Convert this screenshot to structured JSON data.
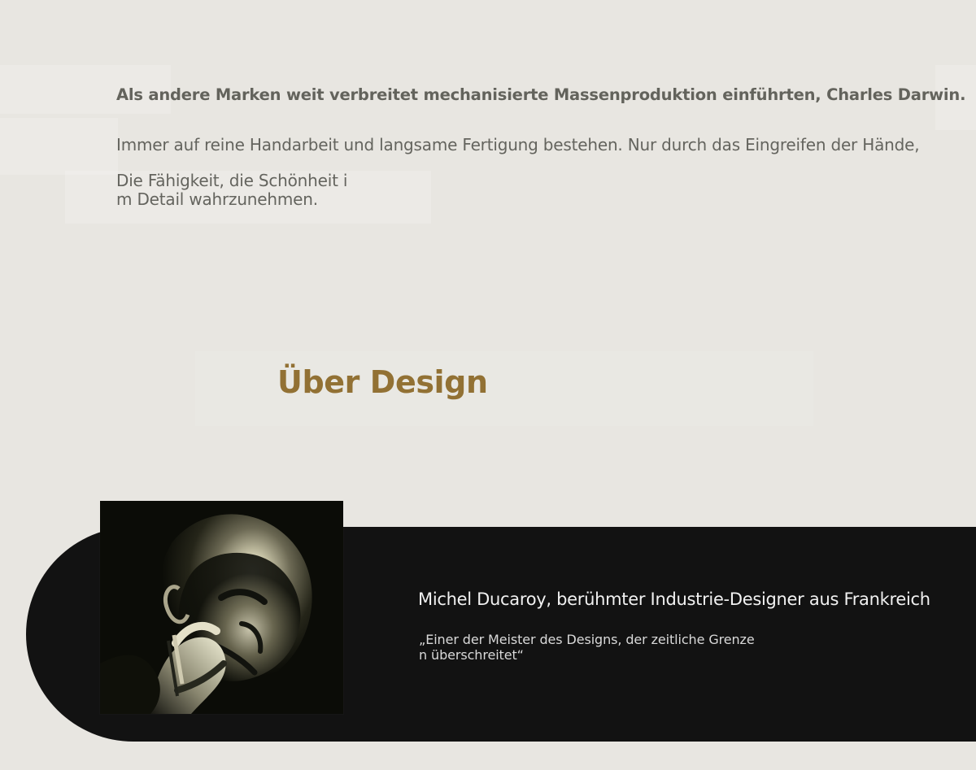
{
  "intro": {
    "bold_line": "Als andere Marken weit verbreitet mechanisierte Massenproduktion einführten, Charles Darwin.",
    "line_one": "Immer auf reine Handarbeit und langsame Fertigung bestehen. Nur durch das Eingreifen der Hände,",
    "line_two": "Die Fähigkeit, die Schönheit im Detail wahrzunehmen."
  },
  "about": {
    "title": "Über Design"
  },
  "designer": {
    "name": "Michel Ducaroy, berühmter Industrie-Designer aus Frankreich",
    "quote": "„Einer der Meister des Designs, der zeitliche Grenzen überschreitet“",
    "portrait_icon": "portrait-photo"
  },
  "colors": {
    "background": "#e8e6e1",
    "accent": "#927134",
    "panel": "#121212"
  }
}
